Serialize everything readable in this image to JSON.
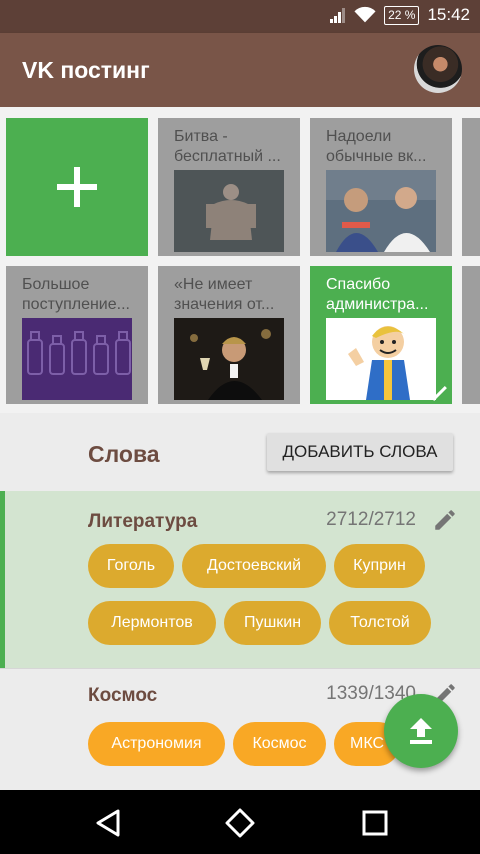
{
  "status_bar": {
    "battery": "22 %",
    "time": "15:42"
  },
  "app_bar": {
    "title": "VK постинг"
  },
  "posts": [
    {
      "text": "Битва -\nбесплатный ...",
      "selected": false
    },
    {
      "text": "Надоели\nобычные вк...",
      "selected": false
    },
    {
      "text": "Большое\nпоступление...",
      "selected": false
    },
    {
      "text": "«Не имеет\nзначения от...",
      "selected": false
    },
    {
      "text": "Спасибо\nадминистра...",
      "selected": true
    }
  ],
  "words": {
    "title": "Слова",
    "add_button": "ДОБАВИТЬ СЛОВА",
    "categories": [
      {
        "name": "Литература",
        "count": "2712/2712",
        "chips": [
          "Гоголь",
          "Достоевский",
          "Куприн",
          "Лермонтов",
          "Пушкин",
          "Толстой"
        ]
      },
      {
        "name": "Космос",
        "count": "1339/1340",
        "chips": [
          "Астрономия",
          "Космос",
          "МКС"
        ]
      }
    ]
  },
  "colors": {
    "primary": "#795548",
    "status_bar": "#5d4037",
    "accent": "#4caf50",
    "chip": "#dcaa2e",
    "title_brown": "#6d4c41"
  },
  "icons": {
    "fab": "upload-icon",
    "edit": "pencil-icon",
    "nav": [
      "back-icon",
      "home-icon",
      "recents-icon"
    ]
  }
}
